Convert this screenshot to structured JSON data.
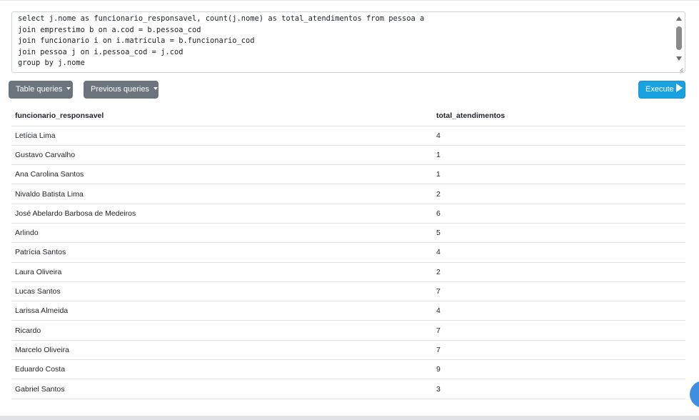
{
  "editor": {
    "query_lines": [
      "select j.nome as funcionario_responsavel, count(j.nome) as total_atendimentos from pessoa a",
      "join emprestimo b on a.cod = b.pessoa_cod",
      "join funcionario i on i.matricula = b.funcionario_cod",
      "join pessoa j on i.pessoa_cod = j.cod",
      "group by j.nome"
    ]
  },
  "toolbar": {
    "table_queries_label": "Table queries",
    "previous_queries_label": "Previous queries",
    "execute_label": "Execute"
  },
  "results": {
    "columns": [
      "funcionario_responsavel",
      "total_atendimentos"
    ],
    "rows": [
      [
        "Letícia Lima",
        "4"
      ],
      [
        "Gustavo Carvalho",
        "1"
      ],
      [
        "Ana Carolina Santos",
        "1"
      ],
      [
        "Nivaldo Batista Lima",
        "2"
      ],
      [
        "José Abelardo Barbosa de Medeiros",
        "6"
      ],
      [
        "Arlindo",
        "5"
      ],
      [
        "Patrícia Santos",
        "4"
      ],
      [
        "Laura Oliveira",
        "2"
      ],
      [
        "Lucas Santos",
        "7"
      ],
      [
        "Larissa Almeida",
        "4"
      ],
      [
        "Ricardo",
        "7"
      ],
      [
        "Marcelo Oliveira",
        "7"
      ],
      [
        "Eduardo Costa",
        "9"
      ],
      [
        "Gabriel Santos",
        "3"
      ]
    ]
  },
  "colors": {
    "secondary_button": "#6c757d",
    "execute_button": "#1aa1e0",
    "floating_button": "#3f8fe0"
  }
}
